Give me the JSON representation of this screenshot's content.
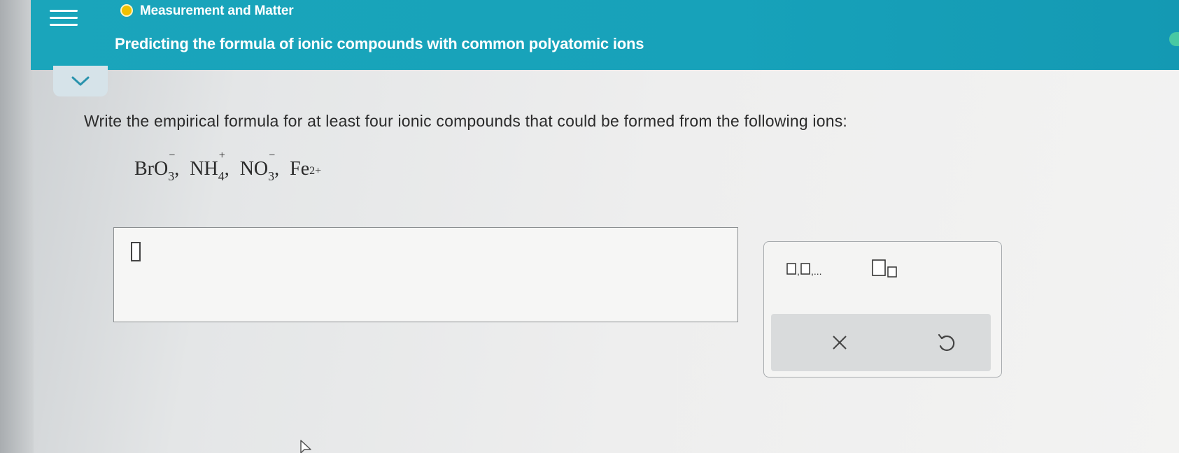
{
  "header": {
    "topic": "Measurement and Matter",
    "title": "Predicting the formula of ionic compounds with common polyatomic ions"
  },
  "question": {
    "prompt": "Write the empirical formula for at least four ionic compounds that could be formed from the following ions:",
    "ions": [
      {
        "base": "BrO",
        "sub": "3",
        "charge": "−"
      },
      {
        "base": "NH",
        "sub": "4",
        "charge": "+"
      },
      {
        "base": "NO",
        "sub": "3",
        "charge": "−"
      },
      {
        "base": "Fe",
        "sub": "",
        "charge": "2+"
      }
    ],
    "separator": ","
  },
  "icons": {
    "menu": "hamburger-menu-icon",
    "topic_status": "progress-dot-icon",
    "collapse": "chevron-down-icon",
    "list_template": "comma-list-template-icon",
    "subscript_template": "subscript-template-icon",
    "clear": "clear-x-icon",
    "undo": "undo-icon"
  },
  "colors": {
    "header": "#17a2ba",
    "status_dot": "#f0c000",
    "collapse_tab": "#d6e3e9"
  }
}
